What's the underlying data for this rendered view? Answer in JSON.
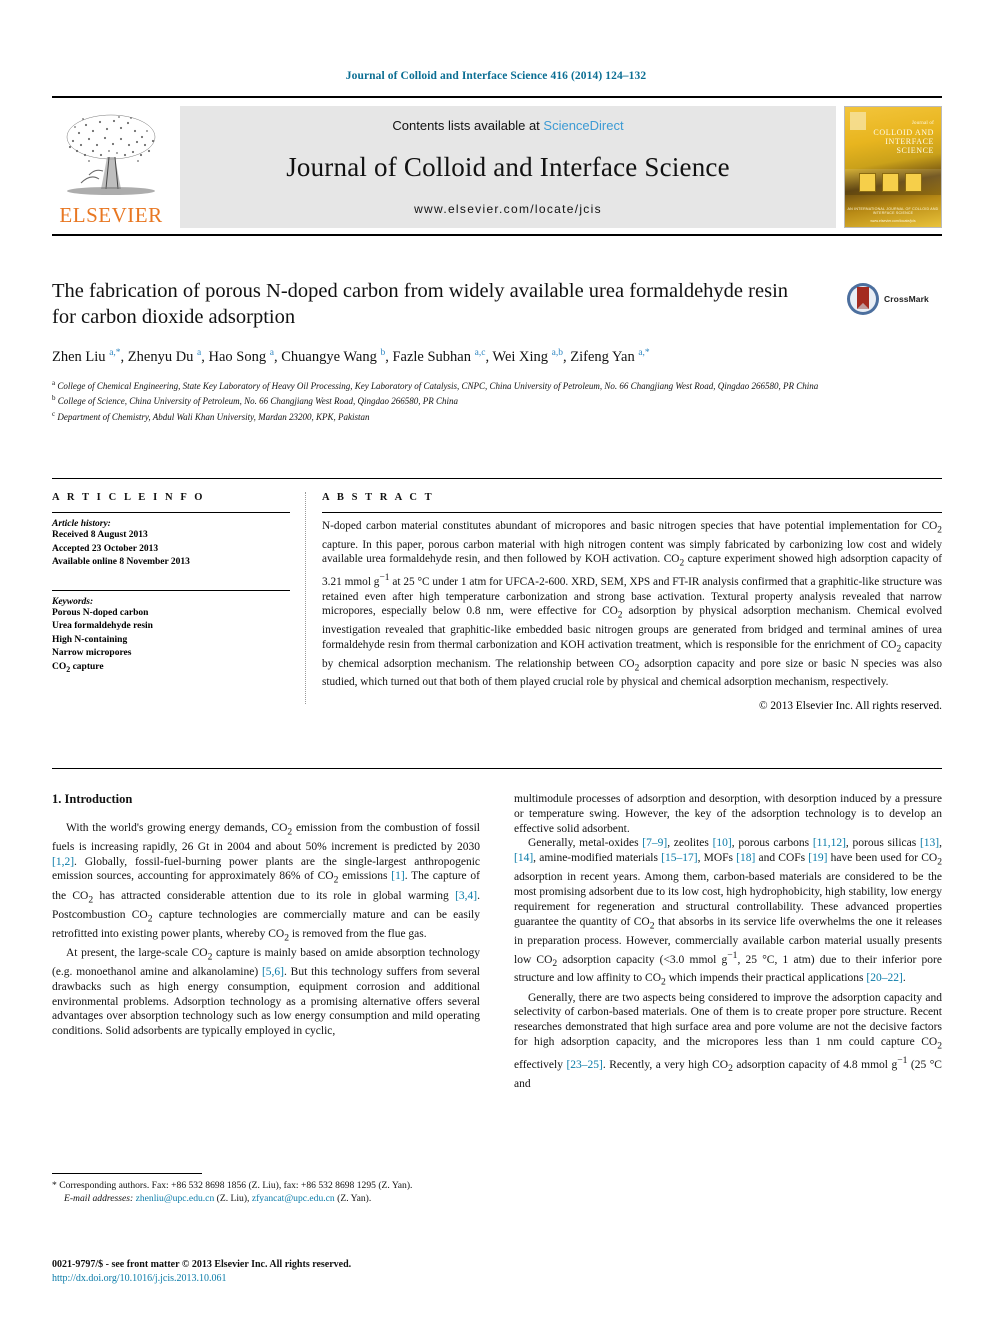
{
  "running_head": "Journal of Colloid and Interface Science 416 (2014) 124–132",
  "banner": {
    "publisher": "ELSEVIER",
    "contents_prefix": "Contents lists available at ",
    "sciencedirect": "ScienceDirect",
    "journal_title": "Journal of Colloid and Interface Science",
    "journal_url": "www.elsevier.com/locate/jcis",
    "cover": {
      "line1": "Journal of",
      "line2": "COLLOID AND",
      "line3": "INTERFACE",
      "line4": "SCIENCE",
      "footer": "AN INTERNATIONAL JOURNAL OF COLLOID AND INTERFACE SCIENCE",
      "footer2": "www.elsevier.com/locate/jcis"
    }
  },
  "title": "The fabrication of porous N-doped carbon from widely available urea formaldehyde resin for carbon dioxide adsorption",
  "crossmark_label": "CrossMark",
  "authors_html": "Zhen Liu <sup>a,*</sup>, Zhenyu Du <sup>a</sup>, Hao Song <sup>a</sup>, Chuangye Wang <sup>b</sup>, Fazle Subhan <sup>a,c</sup>, Wei Xing <sup>a,b</sup>, Zifeng Yan <sup>a,*</sup>",
  "affiliations": [
    "a College of Chemical Engineering, State Key Laboratory of Heavy Oil Processing, Key Laboratory of Catalysis, CNPC, China University of Petroleum, No. 66 Changjiang West Road, Qingdao 266580, PR China",
    "b College of Science, China University of Petroleum, No. 66 Changjiang West Road, Qingdao 266580, PR China",
    "c Department of Chemistry, Abdul Wali Khan University, Mardan 23200, KPK, Pakistan"
  ],
  "article_info": {
    "heading": "A R T I C L E    I N F O",
    "history_label": "Article history:",
    "history": [
      "Received 8 August 2013",
      "Accepted 23 October 2013",
      "Available online 8 November 2013"
    ],
    "keywords_label": "Keywords:",
    "keywords": [
      "Porous N-doped carbon",
      "Urea formaldehyde resin",
      "High N-containing",
      "Narrow micropores",
      "CO2 capture"
    ]
  },
  "abstract": {
    "heading": "A B S T R A C T",
    "text": "N-doped carbon material constitutes abundant of micropores and basic nitrogen species that have potential implementation for CO2 capture. In this paper, porous carbon material with high nitrogen content was simply fabricated by carbonizing low cost and widely available urea formaldehyde resin, and then followed by KOH activation. CO2 capture experiment showed high adsorption capacity of 3.21 mmol g−1 at 25 °C under 1 atm for UFCA-2-600. XRD, SEM, XPS and FT-IR analysis confirmed that a graphitic-like structure was retained even after high temperature carbonization and strong base activation. Textural property analysis revealed that narrow micropores, especially below 0.8 nm, were effective for CO2 adsorption by physical adsorption mechanism. Chemical evolved investigation revealed that graphitic-like embedded basic nitrogen groups are generated from bridged and terminal amines of urea formaldehyde resin from thermal carbonization and KOH activation treatment, which is responsible for the enrichment of CO2 capacity by chemical adsorption mechanism. The relationship between CO2 adsorption capacity and pore size or basic N species was also studied, which turned out that both of them played crucial role by physical and chemical adsorption mechanism, respectively.",
    "copyright": "© 2013 Elsevier Inc. All rights reserved."
  },
  "section_heading": "1. Introduction",
  "body_left": [
    "With the world's growing energy demands, CO2 emission from the combustion of fossil fuels is increasing rapidly, 26 Gt in 2004 and about 50% increment is predicted by 2030 [1,2]. Globally, fossil-fuel-burning power plants are the single-largest anthropogenic emission sources, accounting for approximately 86% of CO2 emissions [1]. The capture of the CO2 has attracted considerable attention due to its role in global warming [3,4]. Postcombustion CO2 capture technologies are commercially mature and can be easily retrofitted into existing power plants, whereby CO2 is removed from the flue gas.",
    "At present, the large-scale CO2 capture is mainly based on amide absorption technology (e.g. monoethanol amine and alkanolamine) [5,6]. But this technology suffers from several drawbacks such as high energy consumption, equipment corrosion and additional environmental problems. Adsorption technology as a promising alternative offers several advantages over absorption technology such as low energy consumption and mild operating conditions. Solid adsorbents are typically employed in cyclic,"
  ],
  "body_right": [
    "multimodule processes of adsorption and desorption, with desorption induced by a pressure or temperature swing. However, the key of the adsorption technology is to develop an effective solid adsorbent.",
    "Generally, metal-oxides [7–9], zeolites [10], porous carbons [11,12], porous silicas [13], [14], amine-modified materials [15–17], MOFs [18] and COFs [19] have been used for CO2 adsorption in recent years. Among them, carbon-based materials are considered to be the most promising adsorbent due to its low cost, high hydrophobicity, high stability, low energy requirement for regeneration and structural controllability. These advanced properties guarantee the quantity of CO2 that absorbs in its service life overwhelms the one it releases in preparation process. However, commercially available carbon material usually presents low CO2 adsorption capacity (<3.0 mmol g−1, 25 °C, 1 atm) due to their inferior pore structure and low affinity to CO2 which impends their practical applications [20–22].",
    "Generally, there are two aspects being considered to improve the adsorption capacity and selectivity of carbon-based materials. One of them is to create proper pore structure. Recent researches demonstrated that high surface area and pore volume are not the decisive factors for high adsorption capacity, and the micropores less than 1 nm could capture CO2 effectively [23–25]. Recently, a very high CO2 adsorption capacity of 4.8 mmol g−1 (25 °C and"
  ],
  "footnotes": {
    "corresponding": "* Corresponding authors. Fax: +86 532 8698 1856 (Z. Liu), fax: +86 532 8698 1295 (Z. Yan).",
    "email_label": "E-mail addresses:",
    "email1": "zhenliu@upc.edu.cn",
    "email1_owner": "(Z. Liu),",
    "email2": "zfyancat@upc.edu.cn",
    "email2_owner": "(Z. Yan)."
  },
  "imprint": {
    "line1": "0021-9797/$ - see front matter © 2013 Elsevier Inc. All rights reserved.",
    "doi": "http://dx.doi.org/10.1016/j.jcis.2013.10.061"
  },
  "colors": {
    "link": "#0b7ba8",
    "sciencedirect": "#3d9bd4",
    "elsevier_orange": "#E87722",
    "runhead": "#0b6e93",
    "banner_bg": "#e6e6e6"
  }
}
